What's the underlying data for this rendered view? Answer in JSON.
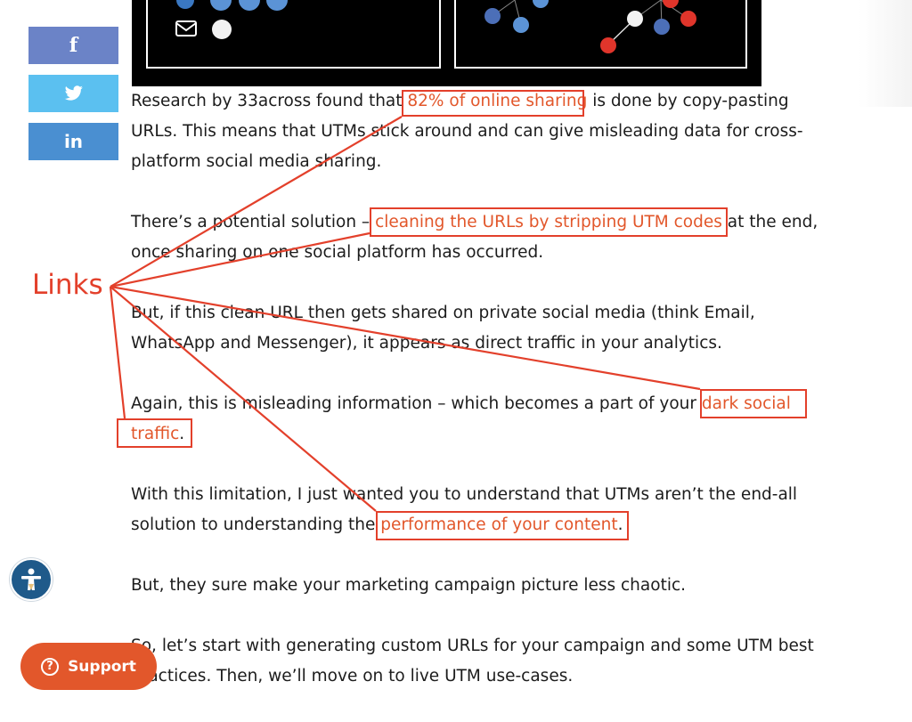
{
  "share": {
    "facebook_label": "f",
    "twitter_label": "",
    "linkedin_label": "in",
    "colors": {
      "facebook": "#6b83c7",
      "twitter": "#5bc0f0",
      "linkedin": "#4a8fd1"
    }
  },
  "article": {
    "p1_before": "Research by 33across found that ",
    "p1_link": "82% of online sharing",
    "p1_after": " is done by copy-pasting URLs.  This means that UTMs stick around and can give misleading data for cross-platform social media sharing.",
    "p2_before": "There’s a potential solution – ",
    "p2_link": "cleaning the URLs by stripping UTM codes",
    "p2_after": " at the end, once sharing on one social platform has occurred.",
    "p3": "But, if this clean URL then gets shared on private social media (think Email, WhatsApp and Messenger), it appears as direct traffic in your analytics.",
    "p4_before": "Again, this is misleading information – which becomes a part of your ",
    "p4_link": "dark social traffic",
    "p4_after": ".",
    "p5_before": "With this limitation, I just wanted you to understand that UTMs aren’t the end-all solution to understanding the ",
    "p5_link": "performance of your content",
    "p5_after": ".",
    "p6": "But, they sure make your marketing campaign picture less chaotic.",
    "p7": "So, let’s start with generating custom URLs for your campaign and some UTM best practices. Then, we’ll move on to live UTM use-cases."
  },
  "annotation": {
    "label": "Links",
    "color": "#e3402b"
  },
  "widgets": {
    "support_label": "Support",
    "support_icon": "?",
    "accessibility_icon": "accessibility-icon"
  }
}
